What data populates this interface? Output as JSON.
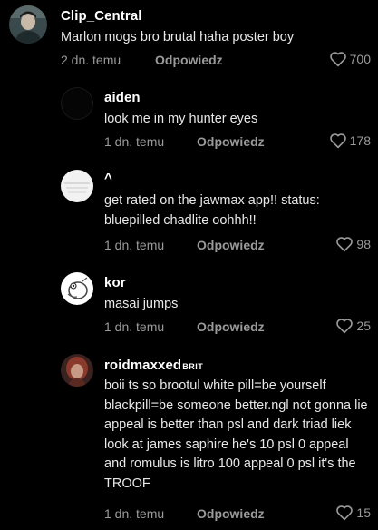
{
  "comments": [
    {
      "username": "Clip_Central",
      "text": "Marlon mogs bro brutal haha poster boy",
      "time": "2 dn. temu",
      "reply_label": "Odpowiedz",
      "likes": "700",
      "avatar": "person-photo"
    },
    {
      "username": "aiden",
      "text": "look me in my hunter eyes",
      "time": "1 dn. temu",
      "reply_label": "Odpowiedz",
      "likes": "178",
      "avatar": "black-circle"
    },
    {
      "username": "^",
      "text": "get rated on the jawmax app!! status: bluepilled chadlite oohhh!!",
      "time": "1 dn. temu",
      "reply_label": "Odpowiedz",
      "likes": "98",
      "avatar": "white-blurred"
    },
    {
      "username": "kor",
      "text": "masai jumps",
      "time": "1 dn. temu",
      "reply_label": "Odpowiedz",
      "likes": "25",
      "avatar": "cartoon-creature"
    },
    {
      "username": "roidmaxxed",
      "username_tag": "BRIT",
      "text": "boii ts so brootul white pill=be yourself blackpill=be someone better.ngl not gonna lie appeal is better than psl and dark triad liek look at james saphire he's 10 psl 0 appeal and romulus is litro 100 appeal 0 psl it's the TROOF",
      "time": "1 dn. temu",
      "reply_label": "Odpowiedz",
      "likes": "15",
      "avatar": "red-hair-person"
    }
  ],
  "colors": {
    "background": "#000000",
    "text": "#ffffff",
    "muted": "#9a9a9a"
  }
}
